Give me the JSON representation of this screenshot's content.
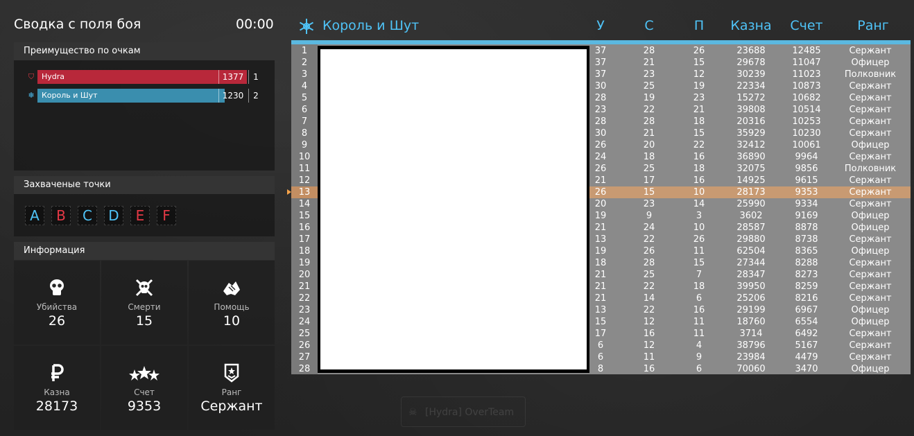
{
  "header": {
    "title": "Сводка с поля боя",
    "timer": "00:00"
  },
  "advantage": {
    "title": "Преимущество по очкам",
    "teams": [
      {
        "name": "Hydra",
        "score": "1377",
        "rank": "1",
        "color": "#b8283a",
        "fill": 1.0
      },
      {
        "name": "Король и Шут",
        "score": "1230",
        "rank": "2",
        "color": "#3a8eae",
        "fill": 0.893
      }
    ]
  },
  "capture": {
    "title": "Захваченые точки",
    "points": [
      {
        "letter": "A",
        "color": "#4fc3f7"
      },
      {
        "letter": "B",
        "color": "#e53946"
      },
      {
        "letter": "C",
        "color": "#4fc3f7"
      },
      {
        "letter": "D",
        "color": "#4fc3f7"
      },
      {
        "letter": "E",
        "color": "#e53946"
      },
      {
        "letter": "F",
        "color": "#e53946"
      }
    ]
  },
  "info": {
    "title": "Информация",
    "stats": [
      {
        "icon": "skull-icon",
        "label": "Убийства",
        "value": "26"
      },
      {
        "icon": "skull-crossbones-icon",
        "label": "Смерти",
        "value": "15"
      },
      {
        "icon": "handshake-icon",
        "label": "Помощь",
        "value": "10"
      },
      {
        "icon": "ruble-icon",
        "label": "Казна",
        "value": "28173"
      },
      {
        "icon": "stars-icon",
        "label": "Счет",
        "value": "9353"
      },
      {
        "icon": "rank-badge-icon",
        "label": "Ранг",
        "value": "Сержант"
      }
    ]
  },
  "scoreboard": {
    "team_name": "Король и Шут",
    "columns": [
      "У",
      "С",
      "П",
      "Казна",
      "Счет",
      "Ранг"
    ],
    "highlight_row": 13,
    "rows": [
      [
        "1",
        "37",
        "28",
        "26",
        "23688",
        "12485",
        "Сержант"
      ],
      [
        "2",
        "37",
        "21",
        "15",
        "29678",
        "11047",
        "Офицер"
      ],
      [
        "3",
        "37",
        "23",
        "12",
        "30239",
        "11023",
        "Полковник"
      ],
      [
        "4",
        "30",
        "25",
        "19",
        "22334",
        "10873",
        "Сержант"
      ],
      [
        "5",
        "28",
        "19",
        "23",
        "15272",
        "10682",
        "Сержант"
      ],
      [
        "6",
        "23",
        "22",
        "21",
        "39808",
        "10514",
        "Сержант"
      ],
      [
        "7",
        "28",
        "28",
        "18",
        "20316",
        "10253",
        "Сержант"
      ],
      [
        "8",
        "30",
        "21",
        "15",
        "35929",
        "10230",
        "Сержант"
      ],
      [
        "9",
        "26",
        "20",
        "22",
        "32412",
        "10061",
        "Офицер"
      ],
      [
        "10",
        "24",
        "18",
        "16",
        "36890",
        "9964",
        "Сержант"
      ],
      [
        "11",
        "26",
        "25",
        "18",
        "32075",
        "9856",
        "Полковник"
      ],
      [
        "12",
        "21",
        "17",
        "16",
        "14925",
        "9615",
        "Сержант"
      ],
      [
        "13",
        "26",
        "15",
        "10",
        "28173",
        "9353",
        "Сержант"
      ],
      [
        "14",
        "20",
        "23",
        "14",
        "25990",
        "9334",
        "Сержант"
      ],
      [
        "15",
        "19",
        "9",
        "3",
        "3602",
        "9169",
        "Офицер"
      ],
      [
        "16",
        "21",
        "24",
        "10",
        "28587",
        "8878",
        "Офицер"
      ],
      [
        "17",
        "13",
        "22",
        "26",
        "29880",
        "8738",
        "Сержант"
      ],
      [
        "18",
        "19",
        "26",
        "11",
        "62504",
        "8365",
        "Офицер"
      ],
      [
        "19",
        "18",
        "28",
        "15",
        "27344",
        "8288",
        "Сержант"
      ],
      [
        "20",
        "21",
        "25",
        "7",
        "28347",
        "8273",
        "Сержант"
      ],
      [
        "21",
        "21",
        "22",
        "18",
        "39950",
        "8259",
        "Сержант"
      ],
      [
        "22",
        "21",
        "14",
        "6",
        "25206",
        "8216",
        "Сержант"
      ],
      [
        "23",
        "13",
        "22",
        "16",
        "29199",
        "6967",
        "Офицер"
      ],
      [
        "24",
        "15",
        "12",
        "11",
        "18760",
        "6554",
        "Офицер"
      ],
      [
        "25",
        "17",
        "16",
        "11",
        "3714",
        "6492",
        "Сержант"
      ],
      [
        "26",
        "6",
        "12",
        "4",
        "38796",
        "5167",
        "Сержант"
      ],
      [
        "27",
        "6",
        "11",
        "9",
        "23984",
        "4479",
        "Сержант"
      ],
      [
        "28",
        "8",
        "16",
        "6",
        "70060",
        "3470",
        "Офицер"
      ]
    ]
  },
  "background": {
    "ghost_label": "[Hydra] OverTeam"
  }
}
